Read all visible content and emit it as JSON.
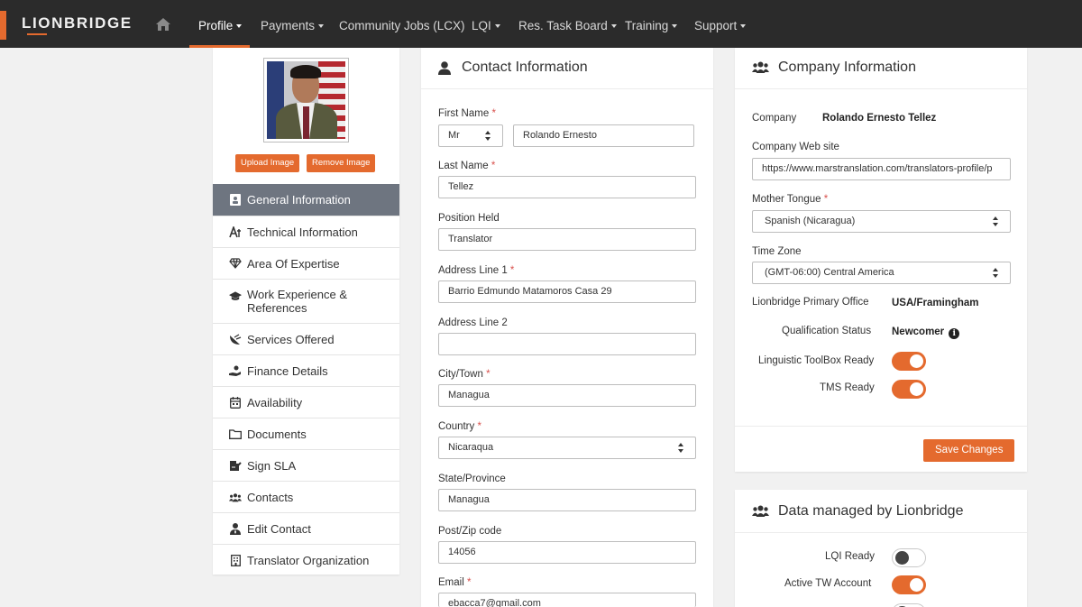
{
  "navbar": {
    "brand": "LIONBRIDGE",
    "items": [
      {
        "label": "Profile",
        "caret": true
      },
      {
        "label": "Payments",
        "caret": true
      },
      {
        "label": "Community Jobs (LCX)",
        "caret": false
      },
      {
        "label": "LQI",
        "caret": true
      },
      {
        "label": "Res. Task Board",
        "caret": true
      },
      {
        "label": "Training",
        "caret": true
      },
      {
        "label": "Support",
        "caret": true
      }
    ],
    "accent_color": "#e46a2e"
  },
  "sidebar": {
    "upload_label": "Upload Image",
    "remove_label": "Remove Image",
    "items": [
      {
        "label": "General Information",
        "icon": "id-card-icon"
      },
      {
        "label": "Technical Information",
        "icon": "language-icon"
      },
      {
        "label": "Area Of Expertise",
        "icon": "gem-icon"
      },
      {
        "label": "Work Experience & References",
        "icon": "graduation-cap-icon"
      },
      {
        "label": "Services Offered",
        "icon": "satellite-dish-icon"
      },
      {
        "label": "Finance Details",
        "icon": "hand-holding-money-icon"
      },
      {
        "label": "Availability",
        "icon": "calendar-icon"
      },
      {
        "label": "Documents",
        "icon": "folder-icon"
      },
      {
        "label": "Sign SLA",
        "icon": "signature-icon"
      },
      {
        "label": "Contacts",
        "icon": "users-icon"
      },
      {
        "label": "Edit Contact",
        "icon": "user-tie-icon"
      },
      {
        "label": "Translator Organization",
        "icon": "building-icon"
      }
    ]
  },
  "contact": {
    "title": "Contact Information",
    "first_name_label": "First Name",
    "salutation": "Mr",
    "first_name": "Rolando Ernesto",
    "last_name_label": "Last Name",
    "last_name": "Tellez",
    "position_label": "Position Held",
    "position": "Translator",
    "address1_label": "Address Line 1",
    "address1": "Barrio Edmundo Matamoros Casa 29",
    "address2_label": "Address Line 2",
    "address2": "",
    "city_label": "City/Town",
    "city": "Managua",
    "country_label": "Country",
    "country": "Nicaraqua",
    "state_label": "State/Province",
    "state": "Managua",
    "zip_label": "Post/Zip code",
    "zip": "14056",
    "email_label": "Email",
    "email": "ebacca7@gmail.com",
    "required_mark": "*"
  },
  "company": {
    "title": "Company Information",
    "company_label": "Company",
    "company": "Rolando Ernesto Tellez",
    "website_label": "Company Web site",
    "website": "https://www.marstranslation.com/translators-profile/p",
    "mother_tongue_label": "Mother Tongue",
    "mother_tongue": "Spanish (Nicaragua)",
    "timezone_label": "Time Zone",
    "timezone": "(GMT-06:00) Central America",
    "office_label": "Lionbridge Primary Office",
    "office": "USA/Framingham",
    "qualification_label": "Qualification Status",
    "qualification": "Newcomer",
    "info_glyph": "i",
    "toolbox_label": "Linguistic ToolBox Ready",
    "toolbox_ready": true,
    "tms_label": "TMS Ready",
    "tms_ready": true,
    "save_label": "Save Changes"
  },
  "managed": {
    "title": "Data managed by Lionbridge",
    "lqi_label": "LQI Ready",
    "lqi_ready": false,
    "tw_label": "Active TW Account",
    "tw_active": true
  }
}
